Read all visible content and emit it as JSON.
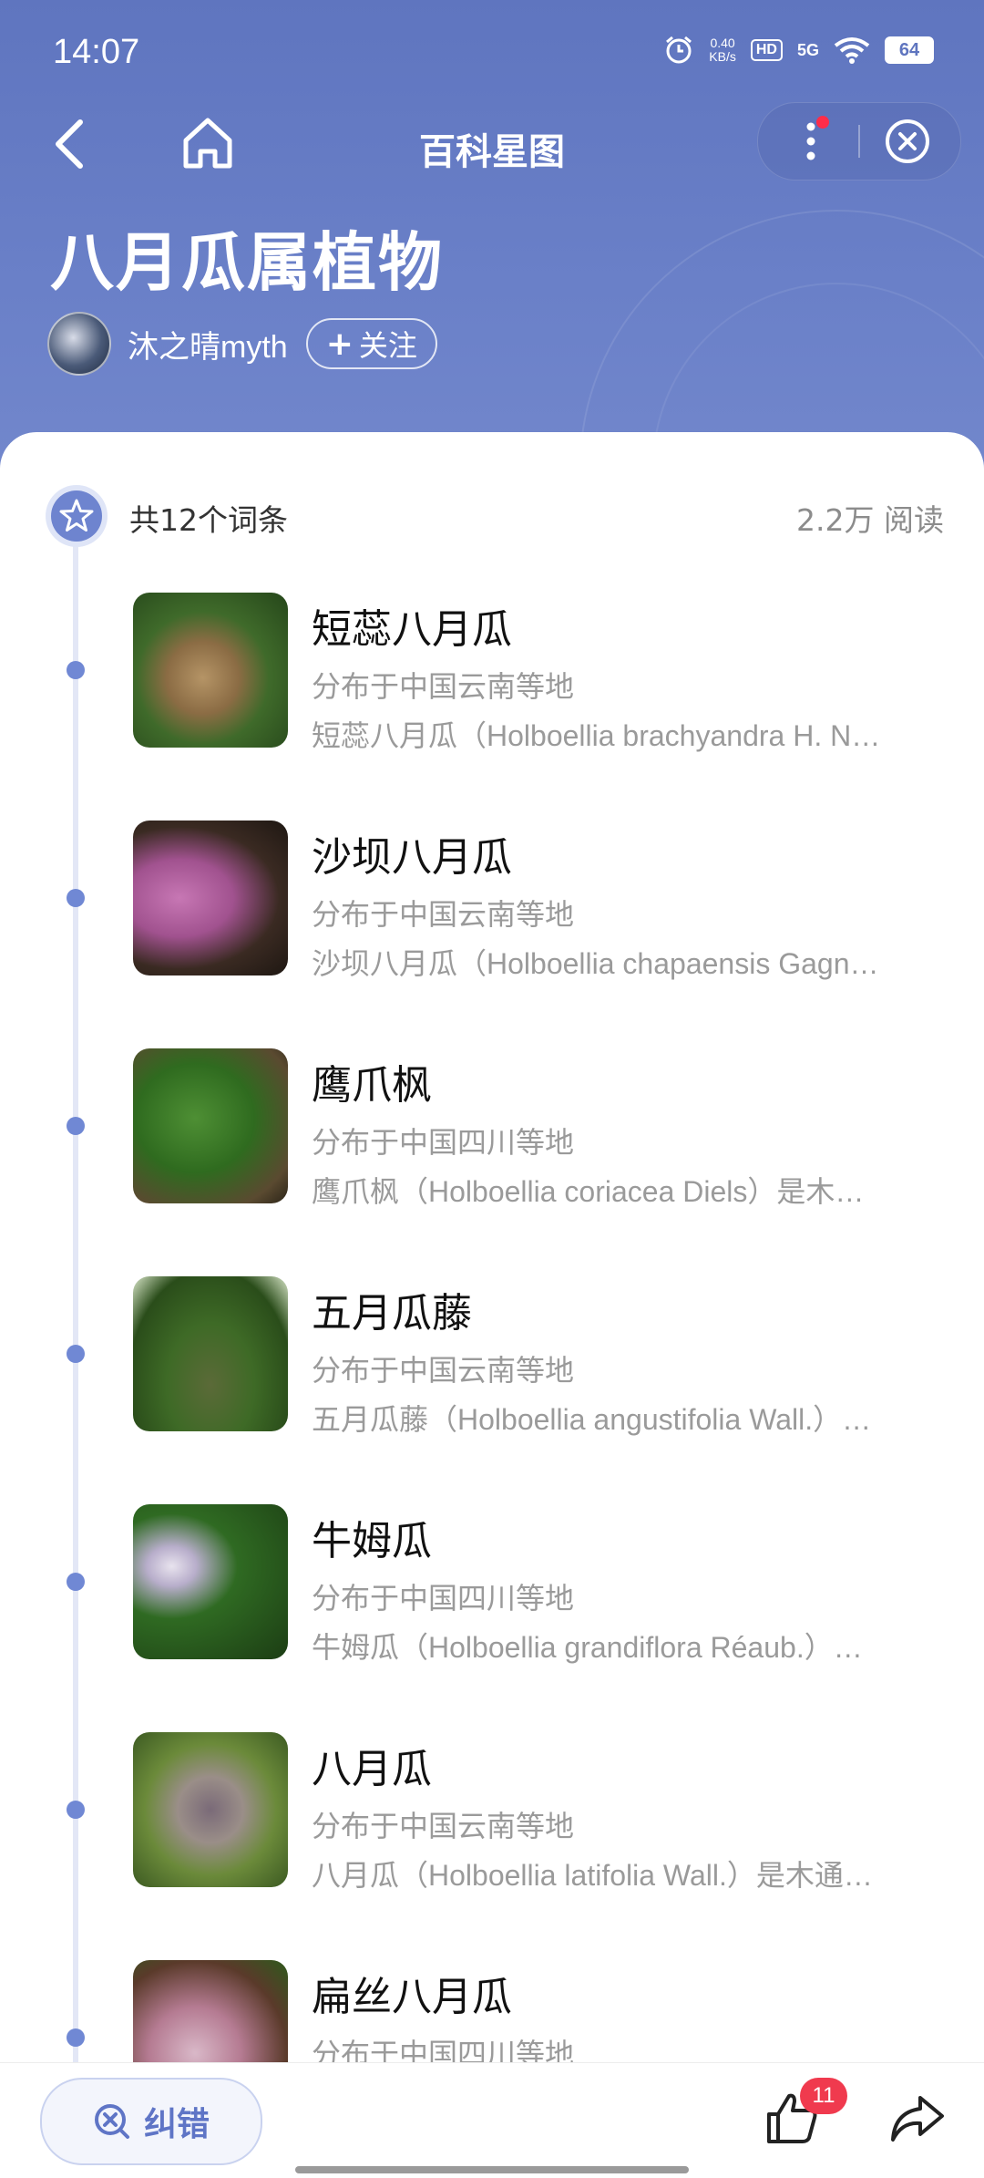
{
  "status_bar": {
    "time": "14:07",
    "net_speed_value": "0.40",
    "net_speed_unit": "KB/s",
    "hd": "HD",
    "signal": "5G",
    "battery": "64"
  },
  "nav": {
    "title": "百科星图"
  },
  "header": {
    "title": "八月瓜属植物",
    "author": "沐之晴myth",
    "follow_label": "关注"
  },
  "summary": {
    "count_text": "共12个词条",
    "reads_text": "2.2万 阅读"
  },
  "items": [
    {
      "title": "短蕊八月瓜",
      "region": "分布于中国云南等地",
      "desc": "短蕊八月瓜（Holboellia brachyandra H. N…"
    },
    {
      "title": "沙坝八月瓜",
      "region": "分布于中国云南等地",
      "desc": "沙坝八月瓜（Holboellia chapaensis Gagn…"
    },
    {
      "title": "鹰爪枫",
      "region": "分布于中国四川等地",
      "desc": "鹰爪枫（Holboellia coriacea Diels）是木…"
    },
    {
      "title": "五月瓜藤",
      "region": "分布于中国云南等地",
      "desc": "五月瓜藤（Holboellia angustifolia Wall.）…"
    },
    {
      "title": "牛姆瓜",
      "region": "分布于中国四川等地",
      "desc": "牛姆瓜（Holboellia grandiflora Réaub.）…"
    },
    {
      "title": "八月瓜",
      "region": "分布于中国云南等地",
      "desc": "八月瓜（Holboellia latifolia Wall.）是木通…"
    },
    {
      "title": "扁丝八月瓜",
      "region": "分布于中国四川等地",
      "desc": ""
    }
  ],
  "bottom": {
    "correct_label": "纠错",
    "like_count": "11"
  }
}
